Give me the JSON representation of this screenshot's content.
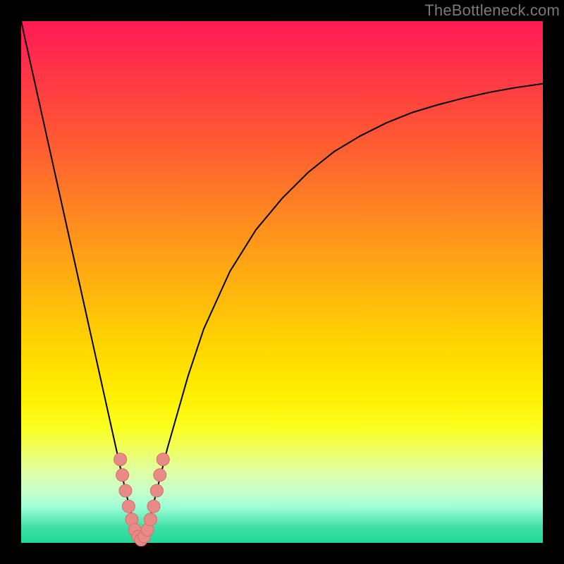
{
  "watermark": "TheBottleneck.com",
  "colors": {
    "frame": "#000000",
    "curve": "#000000",
    "marker_fill": "#e88a85",
    "marker_stroke": "#d46e68",
    "gradient_top": "#ff1a53",
    "gradient_bottom": "#1fd898"
  },
  "chart_data": {
    "type": "line",
    "title": "",
    "xlabel": "",
    "ylabel": "",
    "xlim": [
      0,
      100
    ],
    "ylim": [
      0,
      100
    ],
    "grid": false,
    "legend": false,
    "series": [
      {
        "name": "bottleneck-curve",
        "x": [
          0,
          2,
          4,
          6,
          8,
          10,
          12,
          14,
          16,
          18,
          20,
          21,
          22,
          23,
          24,
          25,
          26,
          28,
          30,
          32,
          35,
          40,
          45,
          50,
          55,
          60,
          65,
          70,
          75,
          80,
          85,
          90,
          95,
          100
        ],
        "y": [
          100,
          91,
          82,
          73,
          64,
          55,
          46,
          37,
          28,
          19,
          10,
          6,
          2,
          0,
          2,
          6,
          10,
          18,
          25,
          32,
          41,
          52,
          60,
          66,
          71,
          75,
          78,
          80.5,
          82.5,
          84,
          85.3,
          86.4,
          87.3,
          88
        ]
      }
    ],
    "markers": [
      {
        "x": 19.0,
        "y": 16
      },
      {
        "x": 19.4,
        "y": 13
      },
      {
        "x": 20.0,
        "y": 10
      },
      {
        "x": 20.6,
        "y": 7
      },
      {
        "x": 21.2,
        "y": 4.5
      },
      {
        "x": 21.8,
        "y": 2.5
      },
      {
        "x": 22.4,
        "y": 1.2
      },
      {
        "x": 23.0,
        "y": 0.6
      },
      {
        "x": 23.6,
        "y": 1.2
      },
      {
        "x": 24.2,
        "y": 2.5
      },
      {
        "x": 24.8,
        "y": 4.5
      },
      {
        "x": 25.4,
        "y": 7
      },
      {
        "x": 26.0,
        "y": 10
      },
      {
        "x": 26.6,
        "y": 13
      },
      {
        "x": 27.2,
        "y": 16
      }
    ]
  }
}
